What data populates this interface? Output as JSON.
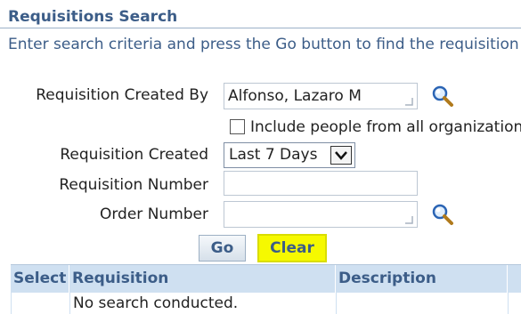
{
  "header": {
    "title": "Requisitions Search",
    "instructions": "Enter search criteria and press the Go button to find the requisition"
  },
  "form": {
    "created_by_label": "Requisition Created By",
    "created_by_value": "Alfonso, Lazaro M",
    "include_all_orgs_label": "Include people from all organization",
    "include_all_orgs_checked": false,
    "created_label": "Requisition Created",
    "created_value": "Last 7 Days",
    "req_number_label": "Requisition Number",
    "req_number_value": "",
    "order_number_label": "Order Number",
    "order_number_value": ""
  },
  "buttons": {
    "go": "Go",
    "clear": "Clear"
  },
  "table": {
    "columns": [
      "Select",
      "Requisition",
      "Description"
    ],
    "empty_message": "No search conducted."
  },
  "icons": {
    "search": "magnifier-icon",
    "lov": "lov-corner-icon",
    "dropdown": "chevron-down-icon"
  },
  "colors": {
    "accent": "#3c5d88",
    "header_bg": "#cfe0f1",
    "highlight": "#f6f900"
  }
}
